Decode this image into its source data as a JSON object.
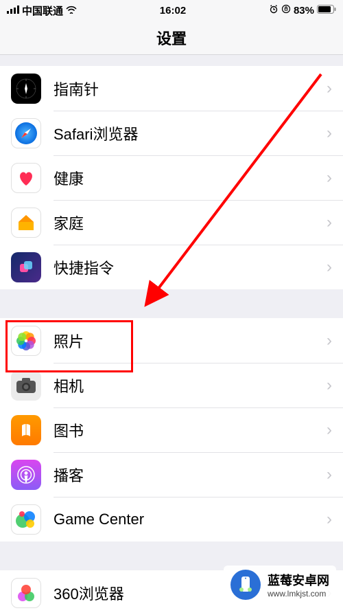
{
  "status_bar": {
    "carrier": "中国联通",
    "time": "16:02",
    "battery_pct": "83%"
  },
  "nav": {
    "title": "设置"
  },
  "group1": [
    {
      "key": "compass",
      "label": "指南针"
    },
    {
      "key": "safari",
      "label": "Safari浏览器"
    },
    {
      "key": "health",
      "label": "健康"
    },
    {
      "key": "home",
      "label": "家庭"
    },
    {
      "key": "shortcuts",
      "label": "快捷指令"
    }
  ],
  "group2": [
    {
      "key": "photos",
      "label": "照片"
    },
    {
      "key": "camera",
      "label": "相机"
    },
    {
      "key": "books",
      "label": "图书"
    },
    {
      "key": "podcasts",
      "label": "播客"
    },
    {
      "key": "gamecenter",
      "label": "Game Center"
    }
  ],
  "group3": [
    {
      "key": "360",
      "label": "360浏览器"
    }
  ],
  "highlight": {
    "target_key": "photos"
  },
  "watermark": {
    "title": "蓝莓安卓网",
    "url": "www.lmkjst.com"
  }
}
